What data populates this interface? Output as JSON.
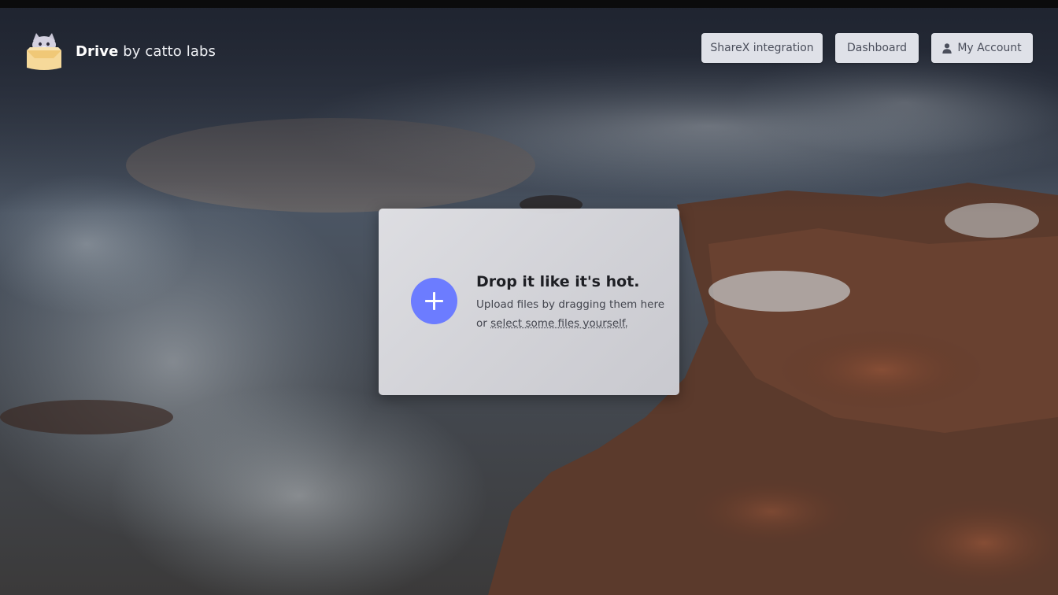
{
  "brand": {
    "name": "Drive",
    "suffix": "by catto labs",
    "logo_icon": "cat-in-box-icon"
  },
  "nav": {
    "sharex_label": "ShareX integration",
    "dashboard_label": "Dashboard",
    "account_label": "My Account",
    "account_icon": "user-icon"
  },
  "upload": {
    "title": "Drop it like it's hot.",
    "line1": "Upload files by dragging them here",
    "line2_prefix": "or ",
    "link_text": "select some files yourself.",
    "add_icon": "plus-icon"
  },
  "colors": {
    "accent": "#6c7cff",
    "button_bg": "#dfe1e8",
    "card_bg": "#dcdce0"
  }
}
